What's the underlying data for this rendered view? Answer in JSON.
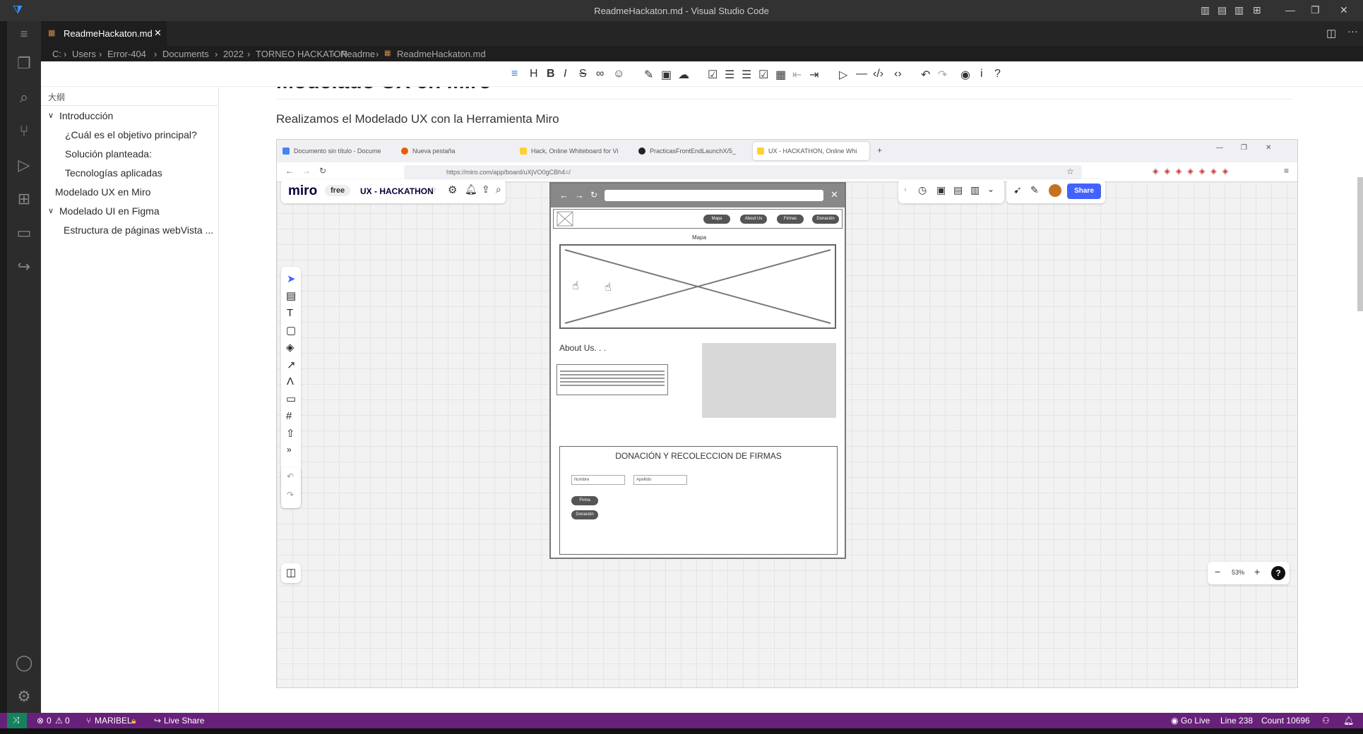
{
  "window": {
    "title": "ReadmeHackaton.md - Visual Studio Code"
  },
  "tab": {
    "label": "ReadmeHackaton.md"
  },
  "breadcrumb": [
    "C:",
    "Users",
    "Error-404",
    "Documents",
    "2022",
    "TORNEO HACKATON",
    "Readme",
    "ReadmeHackaton.md"
  ],
  "outline": {
    "header": "大纲",
    "items": [
      {
        "label": "Introducción",
        "level": 0,
        "expanded": true
      },
      {
        "label": "¿Cuál es el objetivo principal?",
        "level": 1
      },
      {
        "label": "Solución planteada:",
        "level": 1
      },
      {
        "label": "Tecnologías aplicadas",
        "level": 1
      },
      {
        "label": "Modelado UX en Miro",
        "level": 0,
        "expanded": false
      },
      {
        "label": "Modelado UI en Figma",
        "level": 0,
        "expanded": true
      },
      {
        "label": "Estructura de páginas webVista ...",
        "level": 1
      }
    ]
  },
  "doc": {
    "heading_partial": "Modelado UX en Miro",
    "paragraph": "Realizamos el Modelado UX con la Herramienta Miro"
  },
  "browser": {
    "tabs": [
      {
        "label": "Documento sin título - Docume",
        "color": "#4285f4"
      },
      {
        "label": "Nueva pestaña",
        "color": "#e66000"
      },
      {
        "label": "Hack, Online Whiteboard for Vi",
        "color": "#ffd02f"
      },
      {
        "label": "PracticasFrontEndLaunchX/5_",
        "color": "#222222"
      },
      {
        "label": "UX - HACKATHON, Online Whi",
        "color": "#ffd02f"
      }
    ],
    "url": "https://miro.com/app/board/uXjVO0gCBh4=/"
  },
  "miro": {
    "logo": "miro",
    "plan": "free",
    "board_name": "UX - HACKATHON",
    "share_label": "Share",
    "zoom": "53%"
  },
  "wireframe": {
    "nav": [
      "Mapa",
      "About Us",
      "Firmas",
      "Donación"
    ],
    "map_label": "Mapa",
    "about_title": "About Us. . .",
    "form_title": "DONACIÓN Y RECOLECCION DE FIRMAS",
    "field_nombre": "Nombre",
    "field_apellido": "Apellido",
    "btn_firma": "Firma",
    "btn_donacion": "Donación"
  },
  "status": {
    "errors": "0",
    "warnings": "0",
    "branch": "MARIBEL",
    "live_share": "Live Share",
    "go_live": "Go Live",
    "line": "Line 238",
    "count": "Count 10696"
  },
  "colors": {
    "accent": "#68217a",
    "vscode_blue": "#007acc",
    "miro_blue": "#4262ff"
  }
}
